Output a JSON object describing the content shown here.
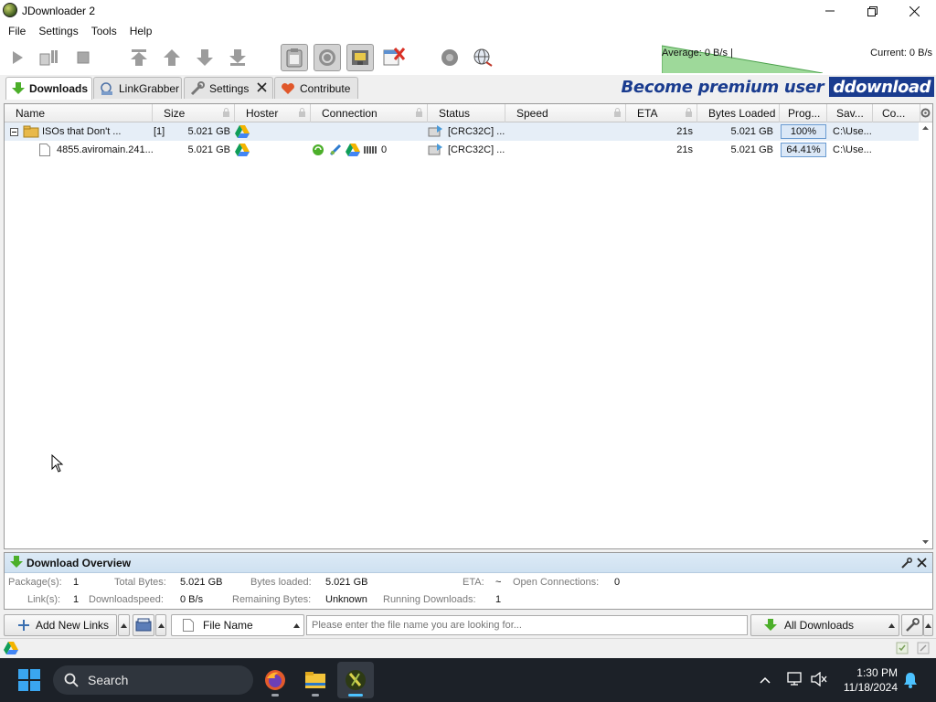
{
  "window": {
    "title": "JDownloader 2"
  },
  "menu": [
    "File",
    "Settings",
    "Tools",
    "Help"
  ],
  "toolbar": {
    "average_speed": "Average: 0 B/s |",
    "current_speed": "Current: 0 B/s"
  },
  "tabs": [
    {
      "label": "Downloads",
      "active": true
    },
    {
      "label": "LinkGrabber",
      "active": false
    },
    {
      "label": "Settings",
      "active": false
    },
    {
      "label": "Contribute",
      "active": false
    }
  ],
  "premium": {
    "text": "Become premium user",
    "brand": "ddownload"
  },
  "table": {
    "columns": [
      "Name",
      "Size",
      "Hoster",
      "Connection",
      "Status",
      "Speed",
      "ETA",
      "Bytes Loaded",
      "Prog...",
      "Sav...",
      "Co..."
    ],
    "rows": [
      {
        "type": "package",
        "expander": "−",
        "name": "ISOs that Don't ...",
        "count": "[1]",
        "size": "5.021 GB",
        "connection_count": "",
        "status": "[CRC32C] ...",
        "speed": "",
        "eta": "21s",
        "bytes_loaded": "5.021 GB",
        "progress": "100%",
        "progress_value": 100,
        "save_to": "C:\\Use..."
      },
      {
        "type": "link",
        "name": "4855.aviromain.241...",
        "size": "5.021 GB",
        "connection_count": "0",
        "status": "[CRC32C] ...",
        "speed": "",
        "eta": "21s",
        "bytes_loaded": "5.021 GB",
        "progress": "64.41%",
        "progress_value": 64.41,
        "save_to": "C:\\Use..."
      }
    ]
  },
  "overview": {
    "title": "Download Overview",
    "packages_label": "Package(s):",
    "packages": "1",
    "total_bytes_label": "Total Bytes:",
    "total_bytes": "5.021 GB",
    "bytes_loaded_label": "Bytes loaded:",
    "bytes_loaded": "5.021 GB",
    "eta_label": "ETA:",
    "eta": "~",
    "open_connections_label": "Open Connections:",
    "open_connections": "0",
    "links_label": "Link(s):",
    "links": "1",
    "downloadspeed_label": "Downloadspeed:",
    "downloadspeed": "0 B/s",
    "remaining_bytes_label": "Remaining Bytes:",
    "remaining_bytes": "Unknown",
    "running_downloads_label": "Running Downloads:",
    "running_downloads": "1"
  },
  "bottom": {
    "add_links": "Add New Links",
    "search_field": "File Name",
    "search_placeholder": "Please enter the file name you are looking for...",
    "filter": "All Downloads"
  },
  "taskbar": {
    "search": "Search",
    "time": "1:30 PM",
    "date": "11/18/2024"
  }
}
